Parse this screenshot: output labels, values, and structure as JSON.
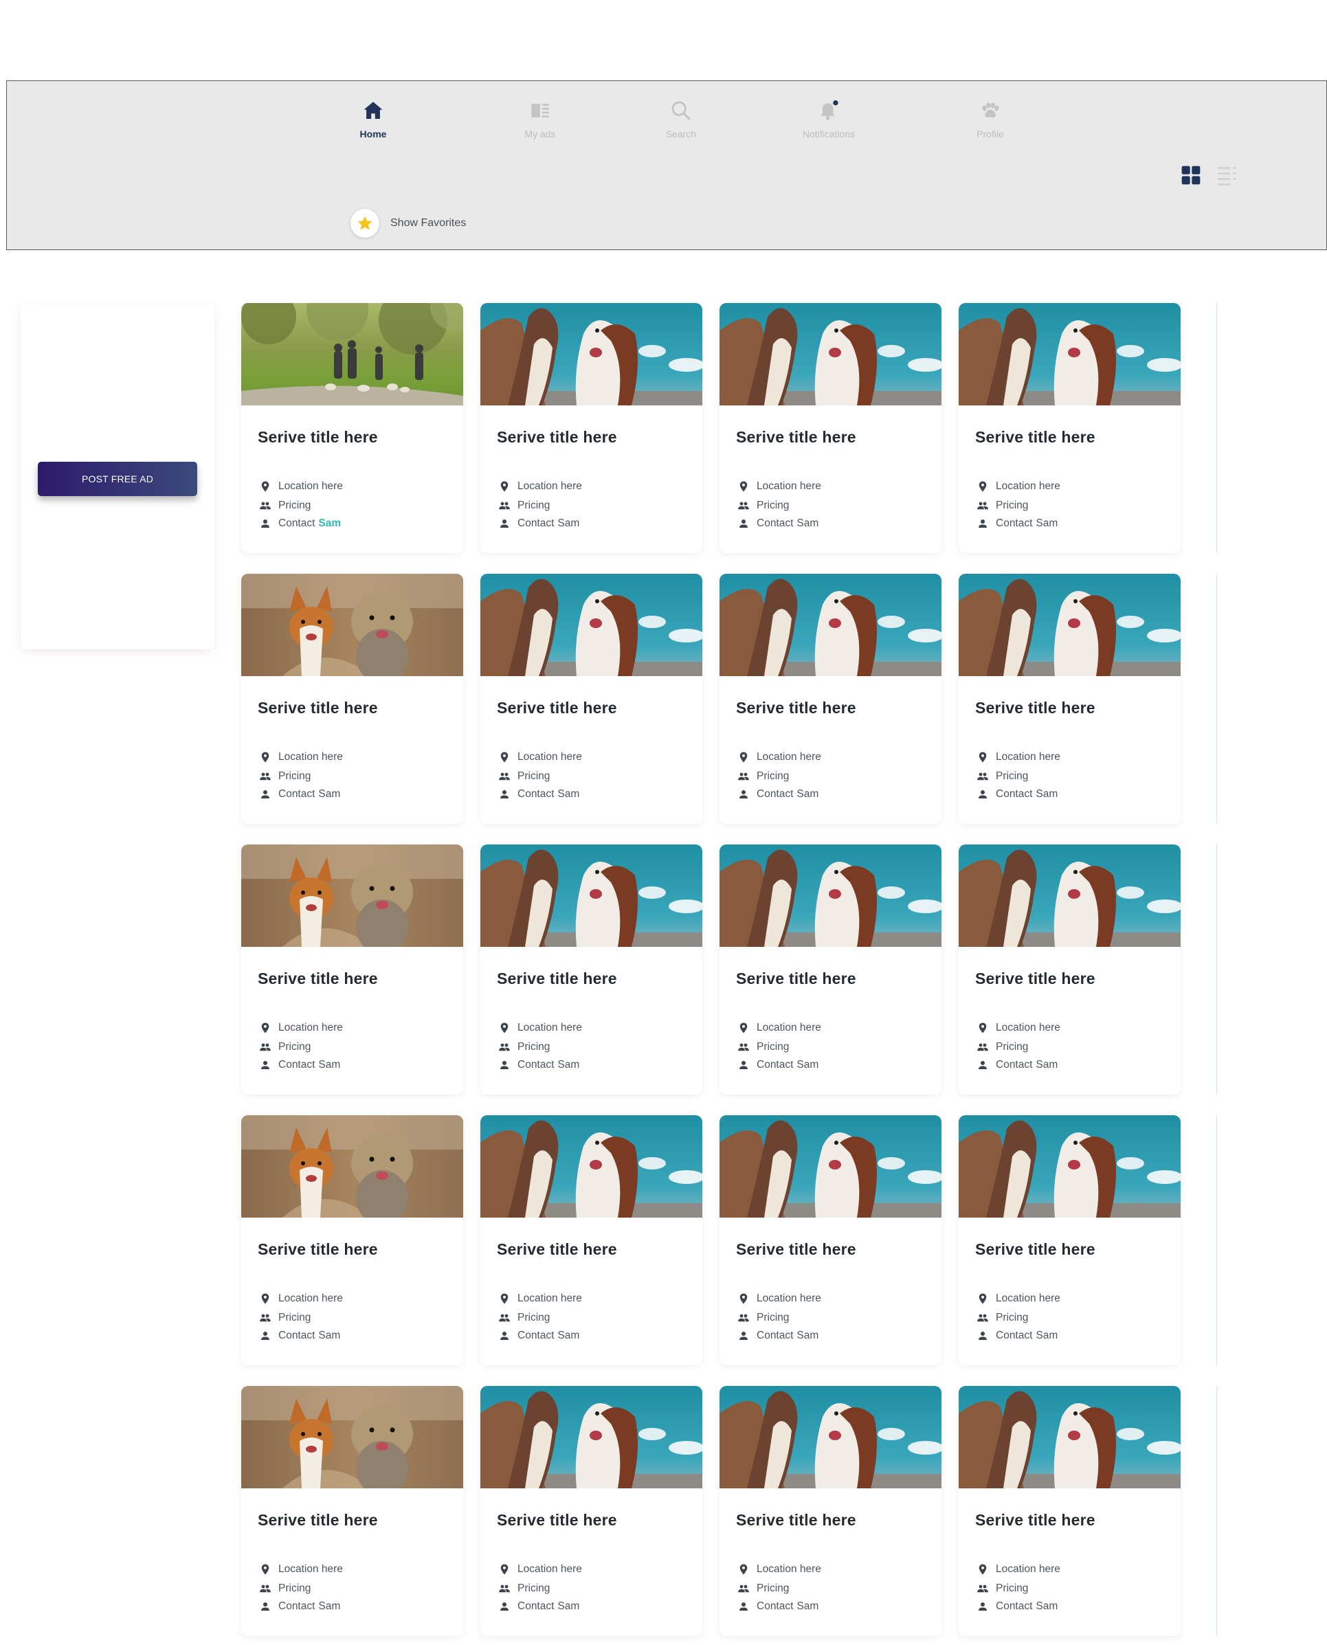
{
  "nav": {
    "items": [
      {
        "id": "home",
        "label": "Home",
        "icon": "home-icon"
      },
      {
        "id": "myads",
        "label": "My ads",
        "icon": "my-ads-icon"
      },
      {
        "id": "search",
        "label": "Search",
        "icon": "search-icon"
      },
      {
        "id": "notifications",
        "label": "Notifications",
        "icon": "bell-icon"
      },
      {
        "id": "profile",
        "label": "Profile",
        "icon": "paw-icon"
      }
    ],
    "active": "Home"
  },
  "view_toggle": {
    "selected": "grid",
    "options": [
      "grid",
      "list"
    ]
  },
  "favorites": {
    "label": "Show Favorites",
    "icon": "star-icon"
  },
  "sidebar": {
    "post_ad_label": "POST FREE AD"
  },
  "card_labels": {
    "title": "Serive title here",
    "location": "Location here",
    "pricing": "Pricing",
    "contact_prefix": "Contact",
    "contact_name": "Sam"
  },
  "cards": [
    {
      "image": "people-walking-dogs",
      "highlight_contact": true
    },
    {
      "image": "two-dogs-sky"
    },
    {
      "image": "two-dogs-sky"
    },
    {
      "image": "two-dogs-sky"
    },
    {
      "image": "corgi-and-yorkie"
    },
    {
      "image": "two-dogs-sky"
    },
    {
      "image": "two-dogs-sky"
    },
    {
      "image": "two-dogs-sky"
    },
    {
      "image": "corgi-and-yorkie"
    },
    {
      "image": "two-dogs-sky"
    },
    {
      "image": "two-dogs-sky"
    },
    {
      "image": "two-dogs-sky"
    },
    {
      "image": "corgi-and-yorkie"
    },
    {
      "image": "two-dogs-sky"
    },
    {
      "image": "two-dogs-sky"
    },
    {
      "image": "two-dogs-sky"
    },
    {
      "image": "corgi-and-yorkie"
    },
    {
      "image": "two-dogs-sky"
    },
    {
      "image": "two-dogs-sky"
    },
    {
      "image": "two-dogs-sky"
    }
  ],
  "colors": {
    "topbar_bg": "#e9e9e9",
    "nav_active": "#1f3458",
    "nav_inactive": "#bdbdbd",
    "contact_highlight": "#2bbdb0",
    "button_gradient_start": "#2f1a6b",
    "button_gradient_end": "#3a4a7c",
    "star": "#f5c518"
  }
}
